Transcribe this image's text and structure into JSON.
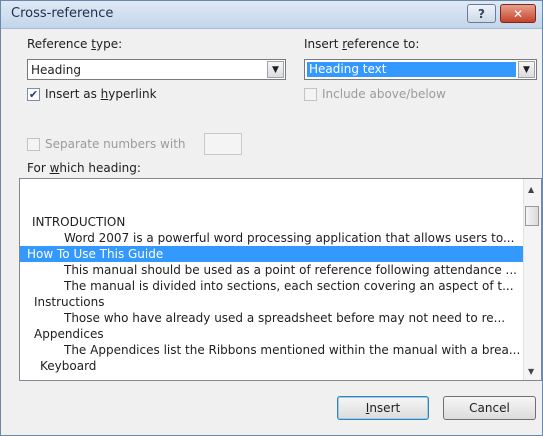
{
  "window": {
    "title": "Cross-reference",
    "help_glyph": "?",
    "close_glyph": "✕"
  },
  "reference_type": {
    "label_pre": "Reference ",
    "label_accel": "t",
    "label_post": "ype:",
    "value": "Heading"
  },
  "insert_reference_to": {
    "label_pre": "Insert ",
    "label_accel": "r",
    "label_post": "eference to:",
    "value": "Heading text"
  },
  "insert_as_hyperlink": {
    "checked": true,
    "label_pre": "Insert as ",
    "label_accel": "h",
    "label_post": "yperlink"
  },
  "include_above_below": {
    "checked": false,
    "enabled": false,
    "label": "Include above/below"
  },
  "separate_numbers": {
    "checked": false,
    "enabled": false,
    "label": "Separate numbers with"
  },
  "for_which_heading": {
    "label_pre": "For ",
    "label_accel": "w",
    "label_post": "hich heading:"
  },
  "headings": [
    {
      "text": "INTRODUCTION",
      "level": 1,
      "selected": false
    },
    {
      "text": "Word 2007 is a powerful word processing application that allows users to...",
      "level": 2,
      "selected": false
    },
    {
      "text": "How To Use This Guide",
      "level": 1,
      "selected": true
    },
    {
      "text": "This manual should be used as a point of reference following attendance ...",
      "level": 2,
      "selected": false
    },
    {
      "text": "The manual is divided into sections, each section covering an aspect of t...",
      "level": 2,
      "selected": false
    },
    {
      "text": "Instructions",
      "level": 1,
      "selected": false
    },
    {
      "text": "Those who have already used a spreadsheet before may not need to re...",
      "level": 2,
      "selected": false
    },
    {
      "text": "Appendices",
      "level": 1,
      "selected": false
    },
    {
      "text": "The Appendices list the Ribbons mentioned within the manual with a brea...",
      "level": 2,
      "selected": false
    },
    {
      "text": "Keyboard",
      "level": 1,
      "selected": false
    }
  ],
  "buttons": {
    "insert_accel": "I",
    "insert_post": "nsert",
    "cancel": "Cancel"
  }
}
